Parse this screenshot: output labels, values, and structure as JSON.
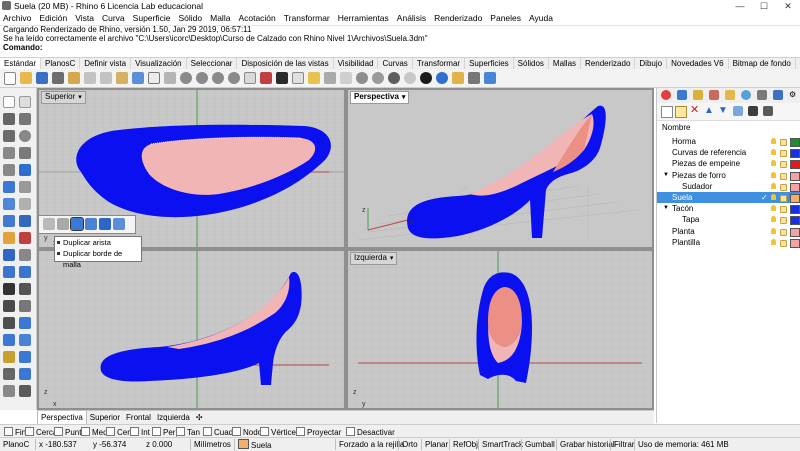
{
  "window": {
    "title": "Suela (20 MB) - Rhino 6 Licencia Lab educacional",
    "minimize": "—",
    "maximize": "☐",
    "close": "✕"
  },
  "menu": [
    "Archivo",
    "Edición",
    "Vista",
    "Curva",
    "Superficie",
    "Sólido",
    "Malla",
    "Acotación",
    "Transformar",
    "Herramientas",
    "Análisis",
    "Renderizado",
    "Paneles",
    "Ayuda"
  ],
  "command_history": {
    "line1": "Cargando Renderizado de Rhino, versión 1.50, Jan 29 2019, 06:57:11",
    "line2": "Se ha leído correctamente el archivo \"C:\\Users\\icorc\\Desktop\\Curso de Calzado con Rhino Nivel 1\\Archivos\\Suela.3dm\"",
    "prompt": "Comando:"
  },
  "toolbar_tabs": [
    "Estándar",
    "PlanosC",
    "Definir vista",
    "Visualización",
    "Seleccionar",
    "Disposición de las vistas",
    "Visibilidad",
    "Curvas",
    "Transformar",
    "Superficies",
    "Sólidos",
    "Mallas",
    "Renderizado",
    "Dibujo",
    "Novedades V6",
    "Bitmap de fondo"
  ],
  "viewports": {
    "top": "Superior",
    "perspective": "Perspectiva",
    "front": "",
    "left": "Izquierda",
    "axis_x": "x",
    "axis_y": "y",
    "axis_z": "z"
  },
  "viewport_tabs": [
    "Perspectiva",
    "Superior",
    "Frontal",
    "Izquierda",
    "✣"
  ],
  "flyout_tooltip": {
    "item1": "Duplicar arista",
    "item2": "Duplicar borde de malla"
  },
  "layers_panel": {
    "header": "Nombre",
    "layers": [
      {
        "name": "Horma",
        "indent": 1,
        "color": "#1e8c2f"
      },
      {
        "name": "Curvas de referencia",
        "indent": 1,
        "color": "#1a2fe0"
      },
      {
        "name": "Piezas de empeine",
        "indent": 1,
        "color": "#e21a1a"
      },
      {
        "name": "Piezas de forro",
        "indent": 1,
        "expander": "▼",
        "color": "#f2a3a3"
      },
      {
        "name": "Sudador",
        "indent": 2,
        "color": "#f2a3a3"
      },
      {
        "name": "Suela",
        "indent": 1,
        "color": "#f3b06d",
        "selected": true,
        "check": "✓"
      },
      {
        "name": "Tacón",
        "indent": 1,
        "expander": "▼",
        "color": "#1a2fe0"
      },
      {
        "name": "Tapa",
        "indent": 2,
        "color": "#1a2fe0"
      },
      {
        "name": "Planta",
        "indent": 1,
        "color": "#f2a3a3"
      },
      {
        "name": "Plantilla",
        "indent": 1,
        "color": "#f2a3a3"
      }
    ]
  },
  "osnaps": [
    {
      "label": "Fin",
      "checked": false
    },
    {
      "label": "Cerca",
      "checked": false
    },
    {
      "label": "Punto",
      "checked": false
    },
    {
      "label": "Med",
      "checked": false
    },
    {
      "label": "Cen",
      "checked": false
    },
    {
      "label": "Int",
      "checked": false
    },
    {
      "label": "Perp",
      "checked": false
    },
    {
      "label": "Tan",
      "checked": false
    },
    {
      "label": "Cuad",
      "checked": false
    },
    {
      "label": "Nodo",
      "checked": false
    },
    {
      "label": "Vértice",
      "checked": false
    },
    {
      "label": "Proyectar",
      "checked": false
    },
    {
      "label": "Desactivar",
      "checked": false
    }
  ],
  "status": {
    "cplane": "PlanoC",
    "x": "x -180.537",
    "y": "y -56.374",
    "z": "z 0.000",
    "units": "Milímetros",
    "layer": "Suela",
    "layer_color": "#f3b06d",
    "grid_snap": "Forzado a la rejilla",
    "ortho": "Orto",
    "planar": "Planar",
    "osnap": "RefObj",
    "smarttrack": "SmartTrack",
    "gumball": "Gumball",
    "history": "Grabar historial",
    "filter": "Filtrar",
    "memory": "Uso de memoria: 461 MB"
  },
  "colors": {
    "sole_blue": "#0a10f0",
    "lining_pink": "#f2b5b5",
    "viewport_bg": "#c8c8c8",
    "selection_blue": "#3f90e0"
  }
}
